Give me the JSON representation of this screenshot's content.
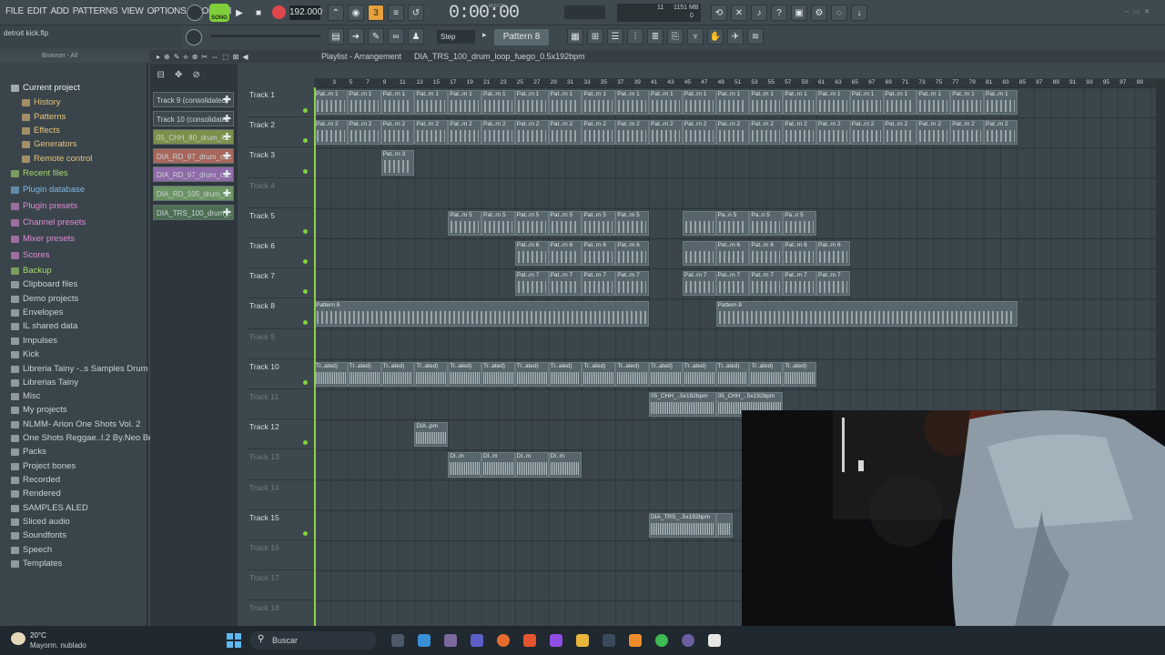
{
  "menu": [
    "FILE",
    "EDIT",
    "ADD",
    "PATTERNS",
    "VIEW",
    "OPTIONS",
    "TOOLS",
    "HELP"
  ],
  "transport": {
    "mode": "SONG",
    "tempo": "192.000",
    "time": "0:00:00",
    "time_unit": "M:S:CS"
  },
  "stats": {
    "cpu": "11",
    "memory": "1151 MB",
    "poly": "0"
  },
  "hint_bar": {
    "project": "detroit kick.flp"
  },
  "toolbar2": {
    "snap": "Step",
    "pattern": "Pattern 8"
  },
  "browser": {
    "header": "Browser - All",
    "items": [
      {
        "label": "Current project",
        "color": "#e8eef0",
        "indent": 12
      },
      {
        "label": "History",
        "color": "#e8c27a",
        "indent": 24
      },
      {
        "label": "Patterns",
        "color": "#e8c27a",
        "indent": 24
      },
      {
        "label": "Effects",
        "color": "#e8c27a",
        "indent": 24
      },
      {
        "label": "Generators",
        "color": "#e8c27a",
        "indent": 24
      },
      {
        "label": "Remote control",
        "color": "#e8c27a",
        "indent": 24
      },
      {
        "label": "Recent files",
        "color": "#a6d96a",
        "indent": 12
      },
      {
        "label": "Plugin database",
        "color": "#7fb8e6",
        "indent": 12
      },
      {
        "label": "Plugin presets",
        "color": "#e08ad8",
        "indent": 12
      },
      {
        "label": "Channel presets",
        "color": "#e08ad8",
        "indent": 12
      },
      {
        "label": "Mixer presets",
        "color": "#e08ad8",
        "indent": 12
      },
      {
        "label": "Scores",
        "color": "#e08ad8",
        "indent": 12
      },
      {
        "label": "Backup",
        "color": "#a6d96a",
        "indent": 12
      },
      {
        "label": "Clipboard files",
        "color": "#c8d2d6",
        "indent": 12
      },
      {
        "label": "Demo projects",
        "color": "#c8d2d6",
        "indent": 12
      },
      {
        "label": "Envelopes",
        "color": "#c8d2d6",
        "indent": 12
      },
      {
        "label": "IL shared data",
        "color": "#c8d2d6",
        "indent": 12
      },
      {
        "label": "Impulses",
        "color": "#c8d2d6",
        "indent": 12
      },
      {
        "label": "Kick",
        "color": "#c8d2d6",
        "indent": 12
      },
      {
        "label": "Libreria Tainy -..s Samples Drum Kit",
        "color": "#c8d2d6",
        "indent": 12
      },
      {
        "label": "Librerias Tainy",
        "color": "#c8d2d6",
        "indent": 12
      },
      {
        "label": "Misc",
        "color": "#c8d2d6",
        "indent": 12
      },
      {
        "label": "My projects",
        "color": "#c8d2d6",
        "indent": 12
      },
      {
        "label": "NLMM- Arion One Shots Vol. 2",
        "color": "#c8d2d6",
        "indent": 12
      },
      {
        "label": "One Shots Reggae..l.2 By.Neo Beats",
        "color": "#c8d2d6",
        "indent": 12
      },
      {
        "label": "Packs",
        "color": "#c8d2d6",
        "indent": 12
      },
      {
        "label": "Project bones",
        "color": "#c8d2d6",
        "indent": 12
      },
      {
        "label": "Recorded",
        "color": "#c8d2d6",
        "indent": 12
      },
      {
        "label": "Rendered",
        "color": "#c8d2d6",
        "indent": 12
      },
      {
        "label": "SAMPLES ALED",
        "color": "#c8d2d6",
        "indent": 12
      },
      {
        "label": "Sliced audio",
        "color": "#c8d2d6",
        "indent": 12
      },
      {
        "label": "Soundfonts",
        "color": "#c8d2d6",
        "indent": 12
      },
      {
        "label": "Speech",
        "color": "#c8d2d6",
        "indent": 12
      },
      {
        "label": "Templates",
        "color": "#c8d2d6",
        "indent": 12
      }
    ]
  },
  "picker": [
    {
      "label": "Track 9 (consolidated)",
      "color": "#3f4a50"
    },
    {
      "label": "Track 10 (consolidate..",
      "color": "#3f4a50"
    },
    {
      "label": "05_CHH_80_drum_lo..",
      "color": "#7d8f4a"
    },
    {
      "label": "DIA_RD_97_drum_ca..",
      "color": "#a8675c"
    },
    {
      "label": "DIA_RD_97_drum_ca..",
      "color": "#8f6aa8"
    },
    {
      "label": "DIA_RD_105_drum_c..",
      "color": "#6d9464"
    },
    {
      "label": "DIA_TRS_100_drum_..",
      "color": "#4f6f55"
    }
  ],
  "playlist": {
    "title": "Playlist - Arrangement",
    "breadcrumb": "DIA_TRS_100_drum_loop_fuego_0.5x192bpm",
    "ruler": [
      "3",
      "5",
      "7",
      "9",
      "11",
      "13",
      "15",
      "17",
      "19",
      "21",
      "23",
      "25",
      "27",
      "29",
      "31",
      "33",
      "35",
      "37",
      "39",
      "41",
      "43",
      "45",
      "47",
      "49",
      "51",
      "53",
      "55",
      "57",
      "59",
      "61",
      "63",
      "65",
      "67",
      "69",
      "71",
      "73",
      "75",
      "77",
      "79",
      "81",
      "83",
      "85",
      "87",
      "89",
      "91",
      "93",
      "95",
      "97",
      "99"
    ],
    "tracks": [
      {
        "name": "Track 1",
        "dim": false
      },
      {
        "name": "Track 2",
        "dim": false
      },
      {
        "name": "Track 3",
        "dim": false
      },
      {
        "name": "Track 4",
        "dim": true
      },
      {
        "name": "Track 5",
        "dim": false
      },
      {
        "name": "Track 6",
        "dim": false
      },
      {
        "name": "Track 7",
        "dim": false
      },
      {
        "name": "Track 8",
        "dim": false
      },
      {
        "name": "Track 9",
        "dim": true
      },
      {
        "name": "Track 10",
        "dim": false
      },
      {
        "name": "Track 11",
        "dim": true
      },
      {
        "name": "Track 12",
        "dim": false
      },
      {
        "name": "Track 13",
        "dim": true
      },
      {
        "name": "Track 14",
        "dim": true
      },
      {
        "name": "Track 15",
        "dim": false
      },
      {
        "name": "Track 16",
        "dim": true
      },
      {
        "name": "Track 17",
        "dim": true
      },
      {
        "name": "Track 18",
        "dim": true
      }
    ],
    "clips": [
      {
        "track": 0,
        "start": 0,
        "len": 42,
        "label": "Pat..rn 1",
        "kind": "notes",
        "step": 2
      },
      {
        "track": 1,
        "start": 0,
        "len": 42,
        "label": "Pat..rn 2",
        "kind": "notes",
        "step": 2
      },
      {
        "track": 2,
        "start": 4,
        "len": 2,
        "label": "Pat..rn 3",
        "kind": "notes",
        "step": 2
      },
      {
        "track": 4,
        "start": 8,
        "len": 12,
        "label": "Pat..rn 5",
        "kind": "notes",
        "step": 2
      },
      {
        "track": 4,
        "start": 22,
        "len": 2,
        "label": "",
        "kind": "notes",
        "step": 2
      },
      {
        "track": 4,
        "start": 24,
        "len": 6,
        "label": "Pa..n 5",
        "kind": "notes",
        "step": 2
      },
      {
        "track": 5,
        "start": 12,
        "len": 8,
        "label": "Pat..rn 6",
        "kind": "notes",
        "step": 2
      },
      {
        "track": 5,
        "start": 22,
        "len": 2,
        "label": "",
        "kind": "notes",
        "step": 2
      },
      {
        "track": 5,
        "start": 24,
        "len": 8,
        "label": "Pat..rn 6",
        "kind": "notes",
        "step": 2
      },
      {
        "track": 6,
        "start": 12,
        "len": 8,
        "label": "Pat..rn 7",
        "kind": "notes",
        "step": 2
      },
      {
        "track": 6,
        "start": 22,
        "len": 10,
        "label": "Pat..rn 7",
        "kind": "notes",
        "step": 2
      },
      {
        "track": 7,
        "start": 0,
        "len": 20,
        "label": "Pattern 8",
        "kind": "notes",
        "step": 20
      },
      {
        "track": 7,
        "start": 24,
        "len": 18,
        "label": "Pattern 8",
        "kind": "notes",
        "step": 18
      },
      {
        "track": 9,
        "start": 0,
        "len": 30,
        "label": "Tr..ated)",
        "kind": "audio",
        "step": 2
      },
      {
        "track": 10,
        "start": 20,
        "len": 8,
        "label": "05_CHH_..5x192bpm",
        "kind": "audio",
        "step": 4
      },
      {
        "track": 11,
        "start": 6,
        "len": 2,
        "label": "DIA..pm",
        "kind": "audio",
        "step": 2
      },
      {
        "track": 12,
        "start": 8,
        "len": 8,
        "label": "DI..m",
        "kind": "audio",
        "step": 2
      },
      {
        "track": 14,
        "start": 20,
        "len": 4,
        "label": "DIA_TRS_..5x192bpm",
        "kind": "audio",
        "step": 4
      },
      {
        "track": 14,
        "start": 24,
        "len": 1,
        "label": "",
        "kind": "audio",
        "step": 1
      }
    ]
  },
  "taskbar": {
    "temp": "20°C",
    "weather": "Mayorm. nublado",
    "search": "Buscar"
  }
}
